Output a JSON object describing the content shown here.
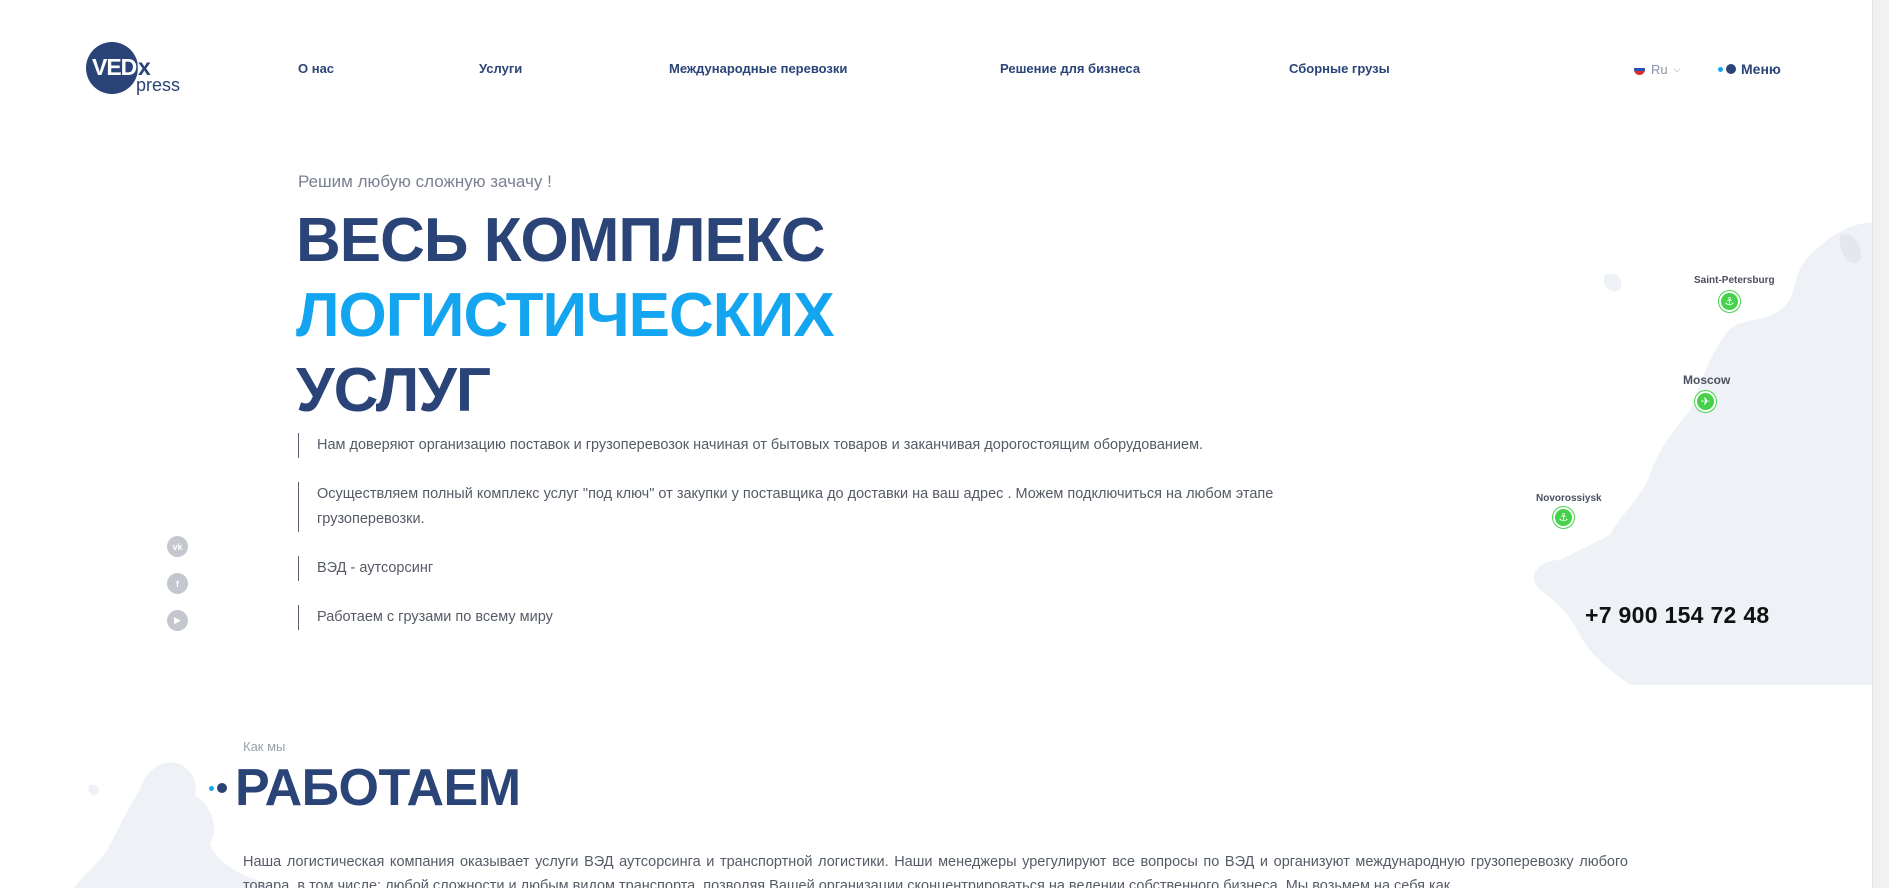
{
  "header": {
    "logo": {
      "ved": "VEDE",
      "ex": "x",
      "press": "press"
    },
    "nav": [
      {
        "label": "О нас"
      },
      {
        "label": "Услуги"
      },
      {
        "label": "Международные перевозки"
      },
      {
        "label": "Решение для бизнеса"
      },
      {
        "label": "Сборные грузы"
      }
    ],
    "lang": {
      "label": "Ru",
      "flag_colors": [
        "#ffffff",
        "#2a4fb5",
        "#e02b2b"
      ]
    },
    "menu_label": "Меню"
  },
  "hero": {
    "subtitle": "Решим любую сложную зачачу !",
    "title_line1": "ВЕСЬ КОМПЛЕКС",
    "title_line2": "ЛОГИСТИЧЕСКИХ",
    "title_line3": "УСЛУГ",
    "bullets": [
      {
        "text": "Нам доверяют организацию поставок и грузоперевозок начиная от бытовых товаров и заканчивая дорогостоящим оборудованием."
      },
      {
        "text": "Осуществляем полный комплекс услуг \"под ключ\" от закупки у поставщика до доставки на ваш адрес . Можем подключиться на любом этапе грузоперевозки."
      },
      {
        "text": "ВЭД - аутсорсинг"
      },
      {
        "text": "Работаем с грузами по всему миру"
      }
    ],
    "socials": [
      {
        "icon": "vk-icon",
        "glyph": "vk"
      },
      {
        "icon": "facebook-icon",
        "glyph": "f"
      },
      {
        "icon": "youtube-icon",
        "glyph": "▶"
      }
    ]
  },
  "map": {
    "cities": [
      {
        "name": "Saint-Petersburg",
        "pin_icon": "anchor-icon",
        "glyph": "⚓"
      },
      {
        "name": "Moscow",
        "pin_icon": "plane-icon",
        "glyph": "✈"
      },
      {
        "name": "Novorossiysk",
        "pin_icon": "anchor-icon",
        "glyph": "⚓"
      }
    ],
    "pin_color": "#45d24a"
  },
  "phone": "+7 900 154 72 48",
  "section_how": {
    "small": "Как мы",
    "title": "РАБОТАЕМ",
    "paragraph": "Наша логистическая компания оказывает услуги ВЭД аутсорсинга и транспортной логистики. Наши менеджеры урегулируют все вопросы по ВЭД и организуют международную грузоперевозку любого товара, в том числе: любой сложности и любым видом транспорта, позволяя Вашей организации сконцентрироваться на ведении собственного бизнеса. Мы возьмем на себя как"
  },
  "colors": {
    "brand_dark": "#2b4478",
    "accent_blue": "#14a5f0",
    "pin_green": "#45d24a"
  }
}
